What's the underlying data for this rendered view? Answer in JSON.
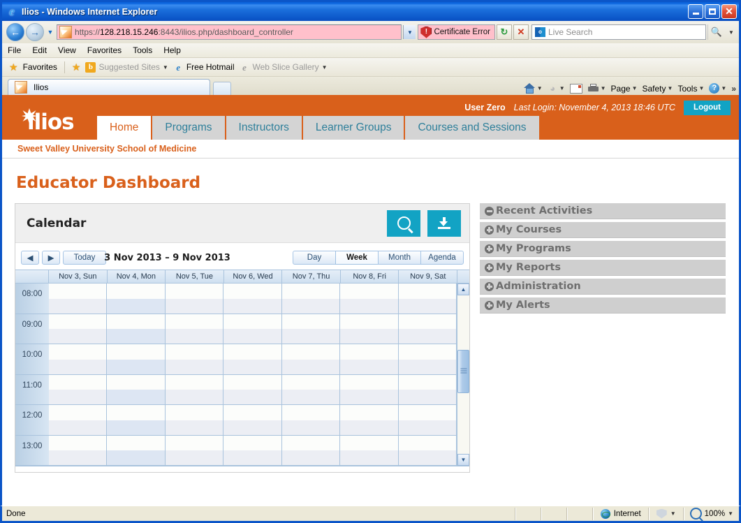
{
  "browser": {
    "title": "Ilios - Windows Internet Explorer",
    "window_buttons": {
      "minimize": "minimize-button",
      "maximize": "maximize-button",
      "close": "close-button"
    },
    "address": {
      "protocol": "https://",
      "host": "128.218.15.246",
      "path": ":8443/ilios.php/dashboard_controller",
      "full": "https://128.218.15.246:8443/ilios.php/dashboard_controller"
    },
    "certificate_error": "Certificate Error",
    "search": {
      "placeholder": "Live Search",
      "provider_icon": "live-search-icon"
    },
    "menu": [
      "File",
      "Edit",
      "View",
      "Favorites",
      "Tools",
      "Help"
    ],
    "favorites_bar": {
      "favorites_label": "Favorites",
      "items": [
        "Suggested Sites",
        "Free Hotmail",
        "Web Slice Gallery"
      ]
    },
    "tabs": [
      {
        "label": "Ilios",
        "active": true
      }
    ],
    "command_bar": [
      "Page",
      "Safety",
      "Tools"
    ],
    "status": {
      "text": "Done",
      "zone": "Internet",
      "zoom": "100%"
    }
  },
  "app": {
    "user": {
      "name": "User Zero",
      "last_login": "Last Login: November 4, 2013 18:46 UTC",
      "logout_label": "Logout"
    },
    "logo_text": "ilios",
    "nav_tabs": [
      {
        "label": "Home",
        "active": true
      },
      {
        "label": "Programs",
        "active": false
      },
      {
        "label": "Instructors",
        "active": false
      },
      {
        "label": "Learner Groups",
        "active": false
      },
      {
        "label": "Courses and Sessions",
        "active": false
      }
    ],
    "school": "Sweet Valley University School of Medicine",
    "page_title": "Educator Dashboard",
    "colors": {
      "brand_orange": "#d9601b",
      "teal": "#12a3c4",
      "tab_inactive": "#d4d4d4",
      "accordion_gray": "#cfcfcf"
    },
    "calendar": {
      "title": "Calendar",
      "actions": [
        {
          "name": "search",
          "icon": "search-icon"
        },
        {
          "name": "download",
          "icon": "download-icon"
        }
      ],
      "toolbar": {
        "prev": "◀",
        "next": "▶",
        "today": "Today",
        "range_title": "3 Nov 2013 – 9 Nov 2013",
        "views": [
          {
            "label": "Day",
            "selected": false
          },
          {
            "label": "Week",
            "selected": true
          },
          {
            "label": "Month",
            "selected": false
          },
          {
            "label": "Agenda",
            "selected": false
          }
        ]
      },
      "days": [
        {
          "label": "Nov 3, Sun",
          "today": false
        },
        {
          "label": "Nov 4, Mon",
          "today": true
        },
        {
          "label": "Nov 5, Tue",
          "today": false
        },
        {
          "label": "Nov 6, Wed",
          "today": false
        },
        {
          "label": "Nov 7, Thu",
          "today": false
        },
        {
          "label": "Nov 8, Fri",
          "today": false
        },
        {
          "label": "Nov 9, Sat",
          "today": false
        }
      ],
      "times": [
        "08:00",
        "09:00",
        "10:00",
        "11:00",
        "12:00",
        "13:00"
      ],
      "events": []
    },
    "sidebar_panels": [
      {
        "label": "Recent Activities",
        "expanded": true
      },
      {
        "label": "My Courses",
        "expanded": false
      },
      {
        "label": "My Programs",
        "expanded": false
      },
      {
        "label": "My Reports",
        "expanded": false
      },
      {
        "label": "Administration",
        "expanded": false
      },
      {
        "label": "My Alerts",
        "expanded": false
      }
    ]
  }
}
